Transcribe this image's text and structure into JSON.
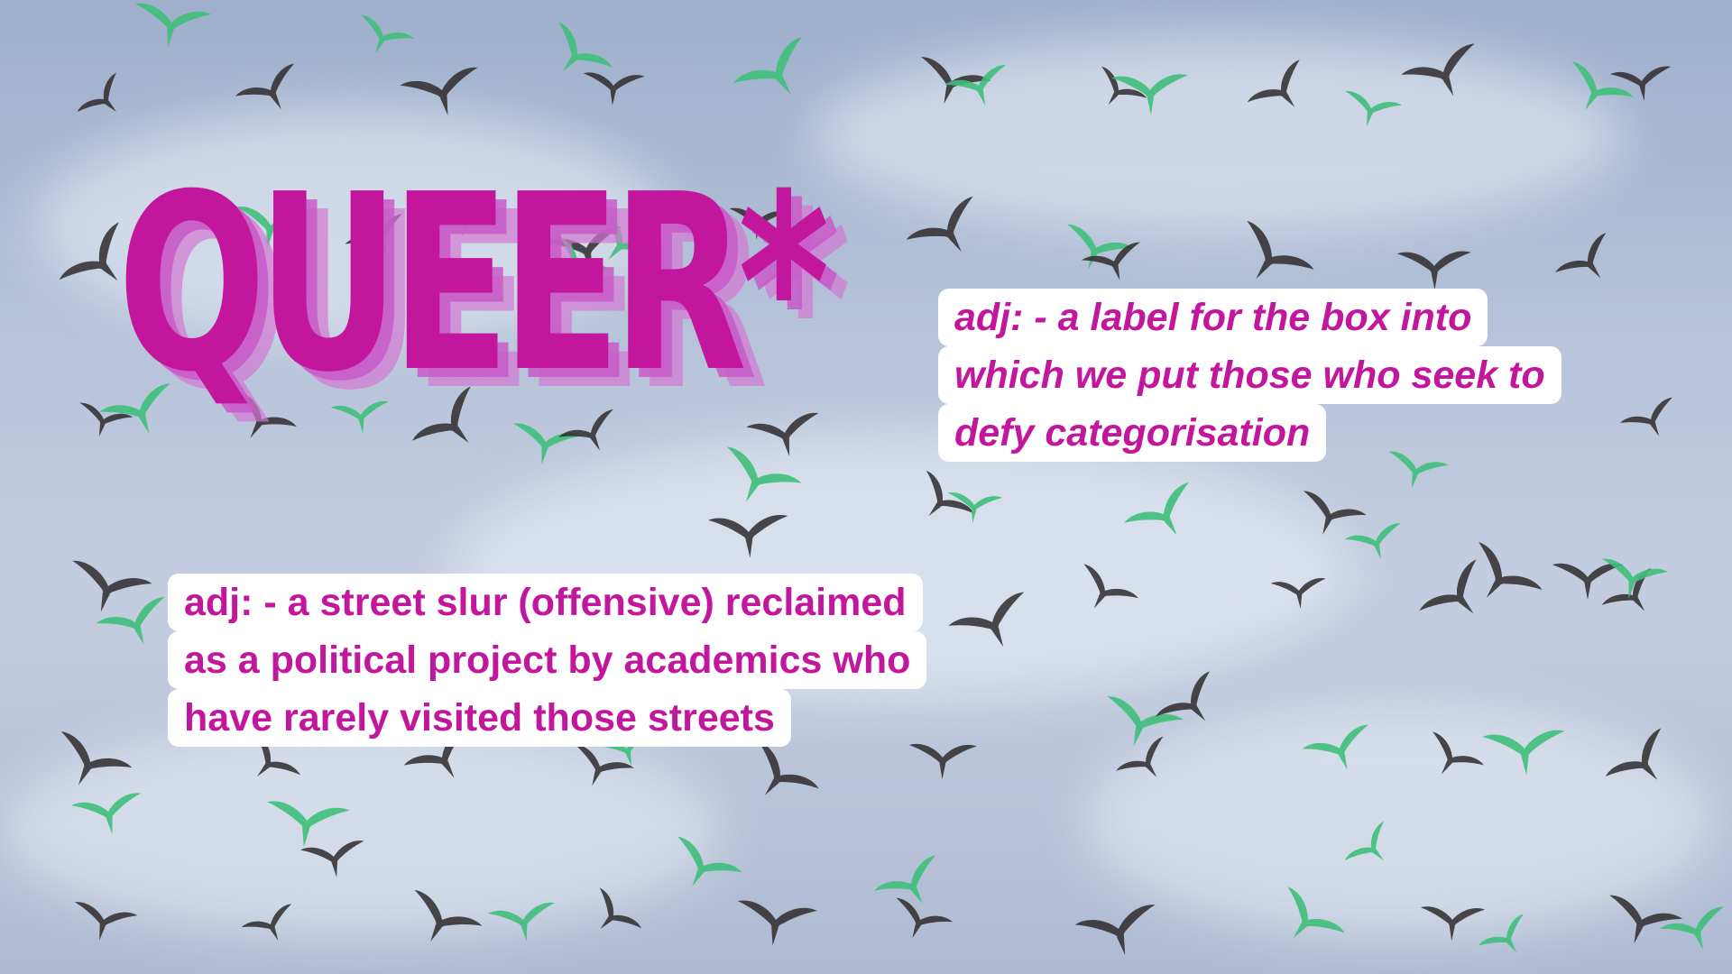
{
  "title": "QUEER*",
  "definitions": [
    {
      "lines": [
        "adj: - a label for the box into",
        "which we put those who seek to",
        "defy categorisation"
      ]
    },
    {
      "lines": [
        "adj: - a street slur (offensive) reclaimed",
        "as a political project by academics who",
        "have rarely visited those streets"
      ]
    }
  ],
  "colors": {
    "accent": "#c2179c",
    "bird_dark": "#2f2a2c",
    "bird_green": "#3fbf7a",
    "sky": "#b6c3d9"
  }
}
